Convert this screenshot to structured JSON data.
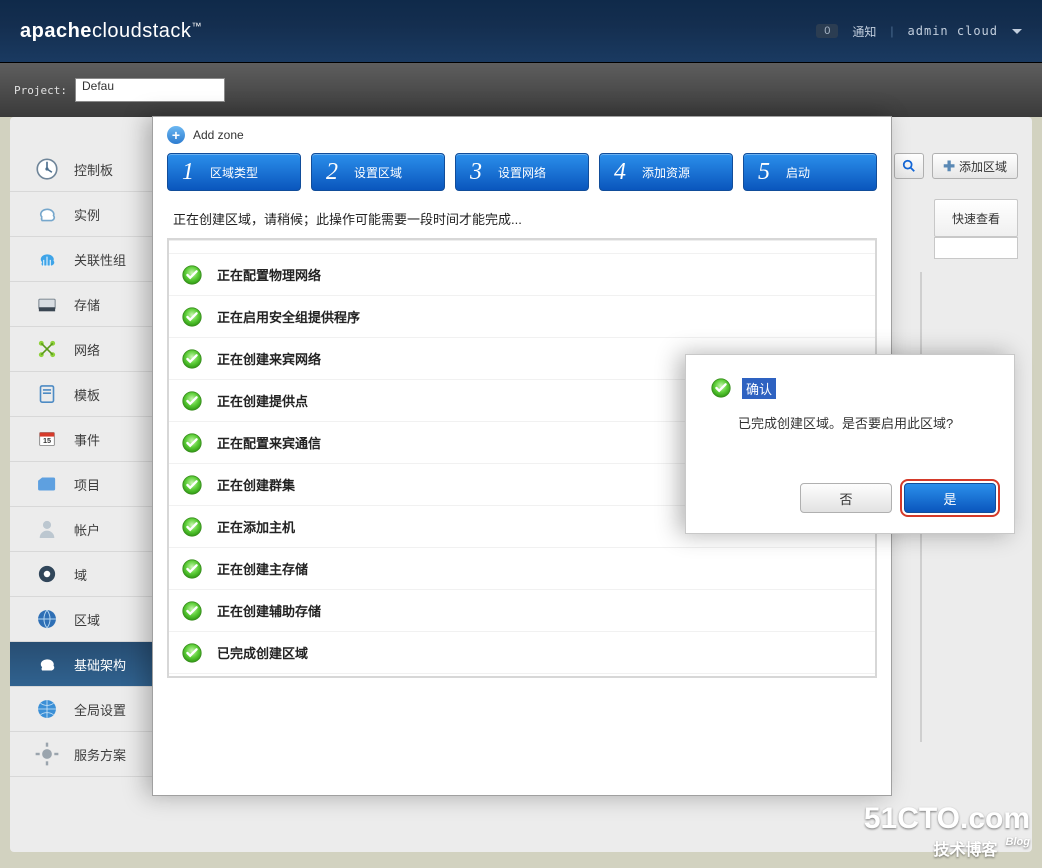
{
  "header": {
    "logo_bold": "apache",
    "logo_light": "cloudstack",
    "logo_tm": "™",
    "notif_count": "0",
    "notif_label": "通知",
    "user": "admin cloud"
  },
  "subheader": {
    "project_label": "Project:",
    "project_selected": "Defau"
  },
  "sidebar": {
    "items": [
      {
        "label": "控制板",
        "active": false
      },
      {
        "label": "实例",
        "active": false
      },
      {
        "label": "关联性组",
        "active": false
      },
      {
        "label": "存储",
        "active": false
      },
      {
        "label": "网络",
        "active": false
      },
      {
        "label": "模板",
        "active": false
      },
      {
        "label": "事件",
        "active": false
      },
      {
        "label": "项目",
        "active": false
      },
      {
        "label": "帐户",
        "active": false
      },
      {
        "label": "域",
        "active": false
      },
      {
        "label": "区域",
        "active": false
      },
      {
        "label": "基础架构",
        "active": true
      },
      {
        "label": "全局设置",
        "active": false
      },
      {
        "label": "服务方案",
        "active": false
      }
    ]
  },
  "toolbar": {
    "add_zone": "添加区域",
    "quick_view": "快速查看"
  },
  "wizard": {
    "title": "Add zone",
    "steps": [
      {
        "num": "1",
        "label": "区域类型"
      },
      {
        "num": "2",
        "label": "设置区域"
      },
      {
        "num": "3",
        "label": "设置网络"
      },
      {
        "num": "4",
        "label": "添加资源"
      },
      {
        "num": "5",
        "label": "启动"
      }
    ],
    "message": "正在创建区域，请稍候；此操作可能需要一段时间才能完成...",
    "tasks": [
      "正在配置物理网络",
      "正在启用安全组提供程序",
      "正在创建来宾网络",
      "正在创建提供点",
      "正在配置来宾通信",
      "正在创建群集",
      "正在添加主机",
      "正在创建主存储",
      "正在创建辅助存储",
      "已完成创建区域"
    ]
  },
  "confirm": {
    "title": "确认",
    "message": "已完成创建区域。是否要启用此区域?",
    "no": "否",
    "yes": "是"
  },
  "watermark": {
    "big": "51CTO.com",
    "small": "技术博客",
    "blog": "Blog"
  }
}
